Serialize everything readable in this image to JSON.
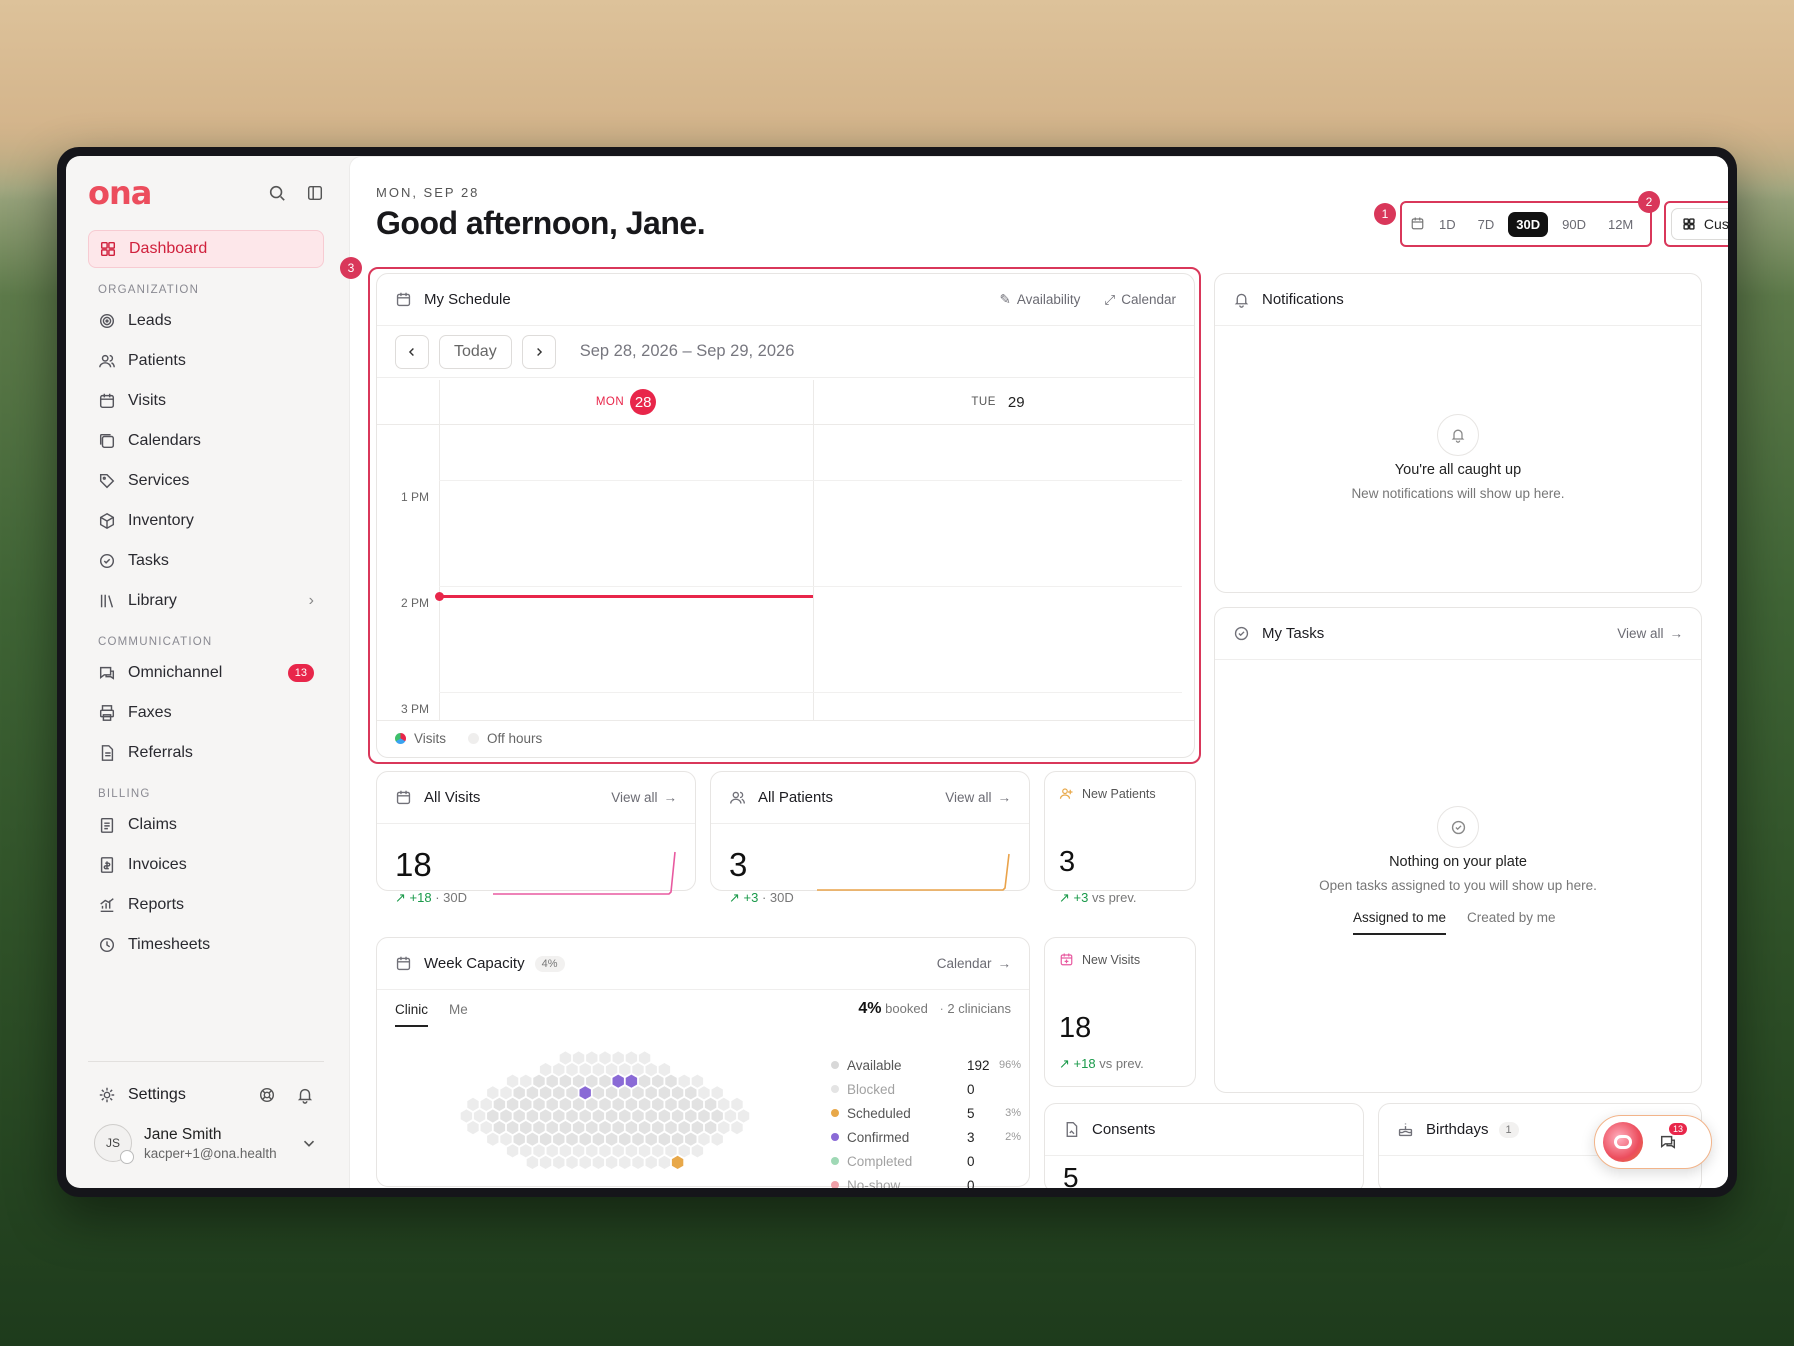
{
  "app": {
    "logo": "ona"
  },
  "sidebar": {
    "dashboard": "Dashboard",
    "sections": {
      "organization": "ORGANIZATION",
      "communication": "COMMUNICATION",
      "billing": "BILLING"
    },
    "organization_items": [
      "Leads",
      "Patients",
      "Visits",
      "Calendars",
      "Services",
      "Inventory",
      "Tasks",
      "Library"
    ],
    "communication_items": [
      "Omnichannel",
      "Faxes",
      "Referrals"
    ],
    "omnichannel_badge": "13",
    "billing_items": [
      "Claims",
      "Invoices",
      "Reports",
      "Timesheets"
    ],
    "settings": "Settings",
    "user": {
      "initials": "JS",
      "name": "Jane Smith",
      "email": "kacper+1@ona.health"
    }
  },
  "header": {
    "date": "MON, SEP 28",
    "greeting": "Good afternoon, Jane.",
    "ranges": [
      "1D",
      "7D",
      "30D",
      "90D",
      "12M"
    ],
    "selected_range": "30D",
    "customize": "Customize",
    "markers": [
      "1",
      "2",
      "3"
    ]
  },
  "schedule": {
    "title": "My Schedule",
    "availability": "Availability",
    "calendar": "Calendar",
    "today": "Today",
    "range": "Sep 28, 2026 – Sep 29, 2026",
    "days": [
      {
        "name": "MON",
        "num": "28"
      },
      {
        "name": "TUE",
        "num": "29"
      }
    ],
    "times": [
      "1 PM",
      "2 PM",
      "3 PM"
    ],
    "legend": [
      "Visits",
      "Off hours"
    ]
  },
  "notifications": {
    "title": "Notifications",
    "empty_title": "You're all caught up",
    "empty_sub": "New notifications will show up here."
  },
  "tasks": {
    "title": "My Tasks",
    "view_all": "View all",
    "empty_title": "Nothing on your plate",
    "empty_sub": "Open tasks assigned to you will show up here.",
    "tabs": [
      "Assigned to me",
      "Created by me"
    ]
  },
  "all_visits": {
    "title": "All Visits",
    "view_all": "View all",
    "value": "18",
    "delta": "+18",
    "period": "· 30D"
  },
  "all_patients": {
    "title": "All Patients",
    "view_all": "View all",
    "value": "3",
    "delta": "+3",
    "period": "· 30D"
  },
  "new_patients": {
    "title": "New Patients",
    "value": "3",
    "delta": "+3",
    "suffix": "vs prev."
  },
  "new_visits": {
    "title": "New Visits",
    "value": "18",
    "delta": "+18",
    "suffix": "vs prev."
  },
  "capacity": {
    "title": "Week Capacity",
    "pct_badge": "4%",
    "calendar": "Calendar",
    "tabs": [
      "Clinic",
      "Me"
    ],
    "booked_pct": "4%",
    "booked_label": "booked",
    "clinicians": "2 clinicians",
    "legend": [
      {
        "label": "Available",
        "value": "192",
        "pct": "96%",
        "color": "#d8d8d8"
      },
      {
        "label": "Blocked",
        "value": "0",
        "pct": "",
        "color": "#e4e4e4"
      },
      {
        "label": "Scheduled",
        "value": "5",
        "pct": "3%",
        "color": "#e8a849"
      },
      {
        "label": "Confirmed",
        "value": "3",
        "pct": "2%",
        "color": "#8a6ad6"
      },
      {
        "label": "Completed",
        "value": "0",
        "pct": "",
        "color": "#9fd8b5"
      },
      {
        "label": "No-show",
        "value": "0",
        "pct": "",
        "color": "#f0a0a8"
      }
    ]
  },
  "consents": {
    "title": "Consents",
    "value": "5"
  },
  "birthdays": {
    "title": "Birthdays",
    "count": "1"
  },
  "chat_badge": "13",
  "colors": {
    "accent": "#e8264a",
    "outline": "#d9375a"
  }
}
